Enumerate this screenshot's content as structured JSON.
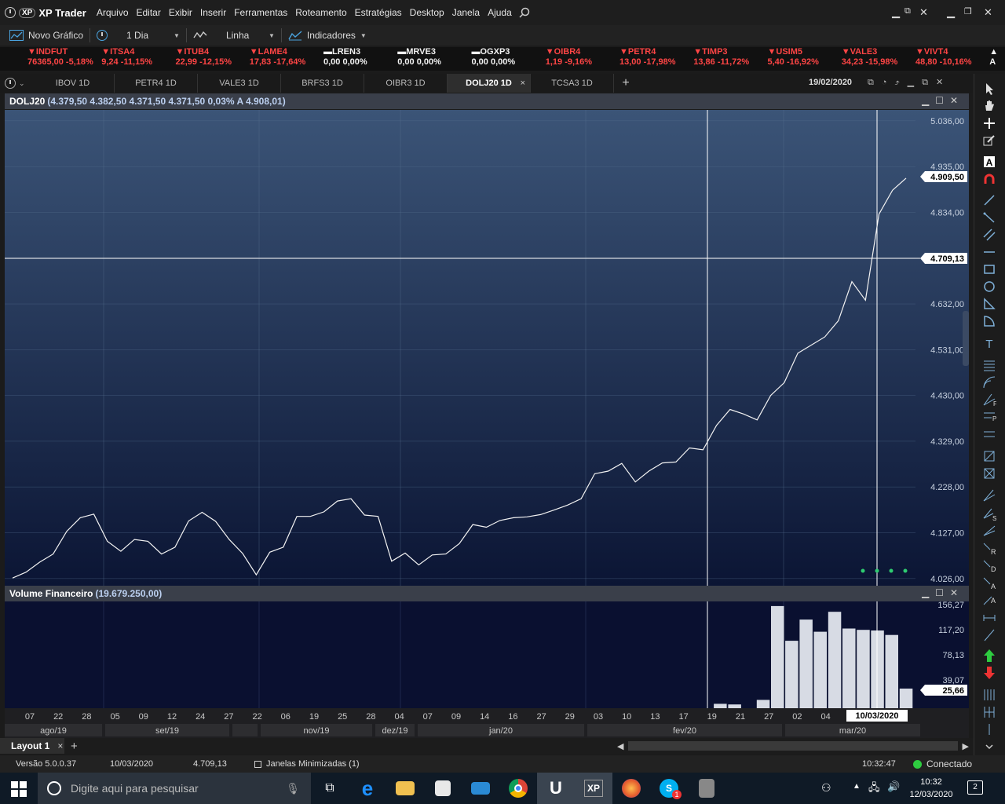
{
  "menubar": {
    "logo_badge": "XP",
    "app_title": "XP Trader",
    "items": [
      "Arquivo",
      "Editar",
      "Exibir",
      "Inserir",
      "Ferramentas",
      "Roteamento",
      "Estratégias",
      "Desktop",
      "Janela",
      "Ajuda"
    ]
  },
  "toolbar": {
    "new_chart": "Novo Gráfico",
    "period": "1 Dia",
    "chart_type": "Linha",
    "indicators": "Indicadores"
  },
  "ticker": [
    {
      "symbol": "INDFUT",
      "arrow": "▼",
      "quote": "76365,00 -5,18%",
      "status": "down"
    },
    {
      "symbol": "ITSA4",
      "arrow": "▼",
      "quote": "9,24 -11,15%",
      "status": "down"
    },
    {
      "symbol": "ITUB4",
      "arrow": "▼",
      "quote": "22,99 -12,15%",
      "status": "down"
    },
    {
      "symbol": "LAME4",
      "arrow": "▼",
      "quote": "17,83 -17,64%",
      "status": "down"
    },
    {
      "symbol": "LREN3",
      "arrow": "▬",
      "quote": "0,00 0,00%",
      "status": "flat"
    },
    {
      "symbol": "MRVE3",
      "arrow": "▬",
      "quote": "0,00 0,00%",
      "status": "flat"
    },
    {
      "symbol": "OGXP3",
      "arrow": "▬",
      "quote": "0,00 0,00%",
      "status": "flat"
    },
    {
      "symbol": "OIBR4",
      "arrow": "▼",
      "quote": "1,19 -9,16%",
      "status": "down"
    },
    {
      "symbol": "PETR4",
      "arrow": "▼",
      "quote": "13,00 -17,98%",
      "status": "down"
    },
    {
      "symbol": "TIMP3",
      "arrow": "▼",
      "quote": "13,86 -11,72%",
      "status": "down"
    },
    {
      "symbol": "USIM5",
      "arrow": "▼",
      "quote": "5,40 -16,92%",
      "status": "down"
    },
    {
      "symbol": "VALE3",
      "arrow": "▼",
      "quote": "34,23 -15,98%",
      "status": "down"
    },
    {
      "symbol": "VIVT4",
      "arrow": "▼",
      "quote": "48,80 -10,16%",
      "status": "down"
    },
    {
      "symbol": "",
      "arrow": "▲",
      "quote": "A",
      "status": "flat"
    }
  ],
  "chart_tabs": [
    "IBOV 1D",
    "PETR4 1D",
    "VALE3 1D",
    "BRFS3 1D",
    "OIBR3 1D",
    "DOLJ20 1D",
    "TCSA3 1D"
  ],
  "active_tab": "DOLJ20 1D",
  "tab_close": "×",
  "add_tab": "+",
  "chart_date": "19/02/2020",
  "main_panel": {
    "symbol": "DOLJ20",
    "ohlc": "(4.379,50  4.382,50  4.371,50  4.371,50  0,03%  A 4.908,01)"
  },
  "volume_panel": {
    "title": "Volume Financeiro",
    "value": "(19.679.250,00)"
  },
  "crosshair": {
    "price_label": "4.709,13",
    "date_label": "10/03/2020"
  },
  "chart_data": [
    {
      "type": "line",
      "name": "DOLJ20",
      "y_ticks": [
        "5.036,00",
        "4.935,00",
        "4.834,00",
        "4.733,00",
        "4.632,00",
        "4.531,00",
        "4.430,00",
        "4.329,00",
        "4.228,00",
        "4.127,00",
        "4.026,00"
      ],
      "ylim": [
        4010,
        5060
      ],
      "last_label": "4.909,50",
      "values": [
        4027,
        4040,
        4062,
        4080,
        4130,
        4160,
        4168,
        4108,
        4086,
        4112,
        4108,
        4080,
        4095,
        4153,
        4172,
        4152,
        4112,
        4081,
        4034,
        4084,
        4095,
        4163,
        4163,
        4173,
        4197,
        4202,
        4166,
        4163,
        4064,
        4082,
        4056,
        4078,
        4080,
        4103,
        4145,
        4139,
        4154,
        4160,
        4162,
        4167,
        4177,
        4188,
        4202,
        4257,
        4263,
        4280,
        4239,
        4263,
        4281,
        4283,
        4314,
        4310,
        4364,
        4399,
        4389,
        4376,
        4430,
        4458,
        4523,
        4541,
        4559,
        4595,
        4681,
        4640,
        4830,
        4883,
        4909.5
      ],
      "x_ticks": [
        "07",
        "22",
        "28",
        "05",
        "09",
        "12",
        "24",
        "27",
        "22",
        "06",
        "19",
        "25",
        "28",
        "04",
        "07",
        "09",
        "14",
        "16",
        "27",
        "29",
        "03",
        "10",
        "13",
        "17",
        "19",
        "21",
        "27",
        "02",
        "04",
        "12"
      ],
      "months": [
        "ago/19",
        "set/19",
        "",
        "nov/19",
        "dez/19",
        "jan/20",
        "fev/20",
        "mar/20"
      ]
    },
    {
      "type": "bar",
      "name": "Volume Financeiro",
      "y_ticks": [
        "156,27",
        "117,20",
        "78,13",
        "39,07"
      ],
      "ylim": [
        0,
        156.27
      ],
      "last_label": "25,66",
      "values": [
        0,
        0,
        0,
        0,
        0,
        0,
        0,
        0,
        0,
        0,
        0,
        0,
        0,
        0,
        0,
        0,
        0,
        0,
        0,
        0,
        0,
        0,
        0,
        0,
        0,
        0,
        0,
        0,
        0,
        0,
        0,
        0,
        0,
        0,
        0,
        0,
        0,
        0,
        0,
        0,
        0,
        0,
        0,
        0,
        0,
        0,
        0,
        0,
        0,
        0,
        0,
        2,
        1,
        0,
        8,
        154,
        100,
        133,
        114,
        145,
        119,
        117,
        116,
        109,
        25.66
      ]
    }
  ],
  "layout": {
    "tab": "Layout 1",
    "tab_close": "×",
    "add": "+"
  },
  "status": {
    "version": "Versão 5.0.0.37",
    "date": "10/03/2020",
    "price": "4.709,13",
    "minimized": "Janelas Minimizadas (1)",
    "time": "10:32:47",
    "connection": "Conectado",
    "connection_color": "#2ecc40"
  },
  "taskbar": {
    "search_placeholder": "Digite aqui para pesquisar",
    "clock_time": "10:32",
    "clock_date": "12/03/2020",
    "notif_count": "2",
    "skype_badge": "1"
  }
}
